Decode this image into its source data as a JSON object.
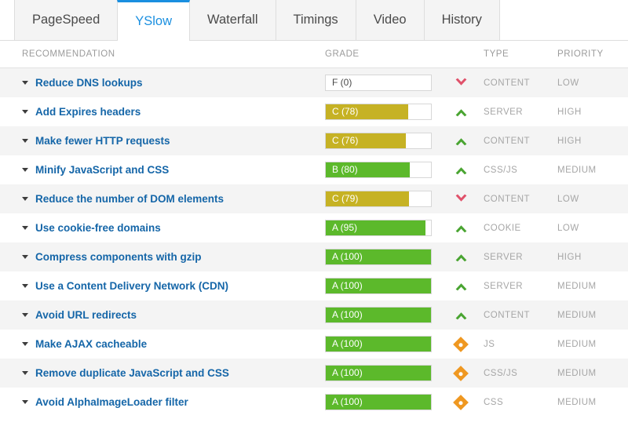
{
  "tabs": [
    {
      "label": "PageSpeed",
      "active": false
    },
    {
      "label": "YSlow",
      "active": true
    },
    {
      "label": "Waterfall",
      "active": false
    },
    {
      "label": "Timings",
      "active": false
    },
    {
      "label": "Video",
      "active": false
    },
    {
      "label": "History",
      "active": false
    }
  ],
  "table": {
    "headers": {
      "recommendation": "RECOMMENDATION",
      "grade": "GRADE",
      "type": "TYPE",
      "priority": "PRIORITY"
    },
    "rows": [
      {
        "recommendation": "Reduce DNS lookups",
        "grade": "F (0)",
        "score": 0,
        "bar_color": "#ffffff",
        "empty": true,
        "status": "down",
        "type": "CONTENT",
        "priority": "LOW"
      },
      {
        "recommendation": "Add Expires headers",
        "grade": "C (78)",
        "score": 78,
        "bar_color": "#c6b224",
        "empty": false,
        "status": "up",
        "type": "SERVER",
        "priority": "HIGH"
      },
      {
        "recommendation": "Make fewer HTTP requests",
        "grade": "C (76)",
        "score": 76,
        "bar_color": "#c6b224",
        "empty": false,
        "status": "up",
        "type": "CONTENT",
        "priority": "HIGH"
      },
      {
        "recommendation": "Minify JavaScript and CSS",
        "grade": "B (80)",
        "score": 80,
        "bar_color": "#5cb92b",
        "empty": false,
        "status": "up",
        "type": "CSS/JS",
        "priority": "MEDIUM"
      },
      {
        "recommendation": "Reduce the number of DOM elements",
        "grade": "C (79)",
        "score": 79,
        "bar_color": "#c6b224",
        "empty": false,
        "status": "down",
        "type": "CONTENT",
        "priority": "LOW"
      },
      {
        "recommendation": "Use cookie-free domains",
        "grade": "A (95)",
        "score": 95,
        "bar_color": "#5cb92b",
        "empty": false,
        "status": "up",
        "type": "COOKIE",
        "priority": "LOW"
      },
      {
        "recommendation": "Compress components with gzip",
        "grade": "A (100)",
        "score": 100,
        "bar_color": "#5cb92b",
        "empty": false,
        "status": "up",
        "type": "SERVER",
        "priority": "HIGH"
      },
      {
        "recommendation": "Use a Content Delivery Network (CDN)",
        "grade": "A (100)",
        "score": 100,
        "bar_color": "#5cb92b",
        "empty": false,
        "status": "up",
        "type": "SERVER",
        "priority": "MEDIUM"
      },
      {
        "recommendation": "Avoid URL redirects",
        "grade": "A (100)",
        "score": 100,
        "bar_color": "#5cb92b",
        "empty": false,
        "status": "up",
        "type": "CONTENT",
        "priority": "MEDIUM"
      },
      {
        "recommendation": "Make AJAX cacheable",
        "grade": "A (100)",
        "score": 100,
        "bar_color": "#5cb92b",
        "empty": false,
        "status": "neutral",
        "type": "JS",
        "priority": "MEDIUM"
      },
      {
        "recommendation": "Remove duplicate JavaScript and CSS",
        "grade": "A (100)",
        "score": 100,
        "bar_color": "#5cb92b",
        "empty": false,
        "status": "neutral",
        "type": "CSS/JS",
        "priority": "MEDIUM"
      },
      {
        "recommendation": "Avoid AlphaImageLoader filter",
        "grade": "A (100)",
        "score": 100,
        "bar_color": "#5cb92b",
        "empty": false,
        "status": "neutral",
        "type": "CSS",
        "priority": "MEDIUM"
      }
    ]
  },
  "colors": {
    "accent_blue": "#1a8fe0",
    "link_blue": "#1566a8",
    "grade_green": "#5cb92b",
    "grade_yellow": "#c6b224",
    "status_up": "#49a431",
    "status_down": "#e0516a",
    "status_neutral": "#ef9821",
    "row_alt": "#f4f4f4"
  },
  "icons": {
    "expand": "triangle-down-icon",
    "status_up": "chevron-up-icon",
    "status_down": "chevron-down-icon",
    "status_neutral": "diamond-icon"
  }
}
